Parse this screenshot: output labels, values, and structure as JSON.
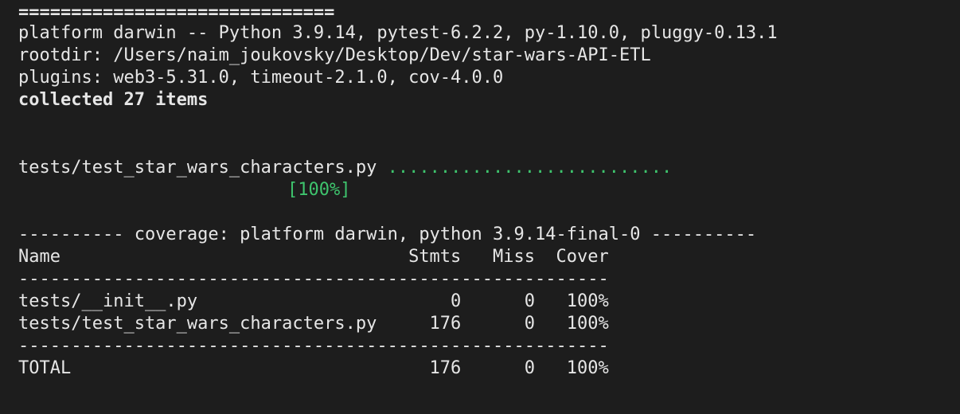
{
  "terminal": {
    "separator_top": "==============================",
    "platform_line": "platform darwin -- Python 3.9.14, pytest-6.2.2, py-1.10.0, pluggy-0.13.1",
    "rootdir_line": "rootdir: /Users/naim_joukovsky/Desktop/Dev/star-wars-API-ETL",
    "plugins_line": "plugins: web3-5.31.0, timeout-2.1.0, cov-4.0.0",
    "collected_line": "collected 27 items",
    "test_file": "tests/test_star_wars_characters.py ",
    "test_dots": "...........................",
    "test_percent": "[100%]",
    "coverage_header": "---------- coverage: platform darwin, python 3.9.14-final-0 ----------",
    "table_header": "Name                                 Stmts   Miss  Cover",
    "table_separator": "--------------------------------------------------------",
    "rows": [
      "tests/__init__.py                        0      0   100%",
      "tests/test_star_wars_characters.py     176      0   100%"
    ],
    "table_separator_bottom": "--------------------------------------------------------",
    "total_row": "TOTAL                                  176      0   100%"
  },
  "colors": {
    "background": "#1d1d1d",
    "text": "#e6e6e6",
    "success": "#3ec46d"
  }
}
